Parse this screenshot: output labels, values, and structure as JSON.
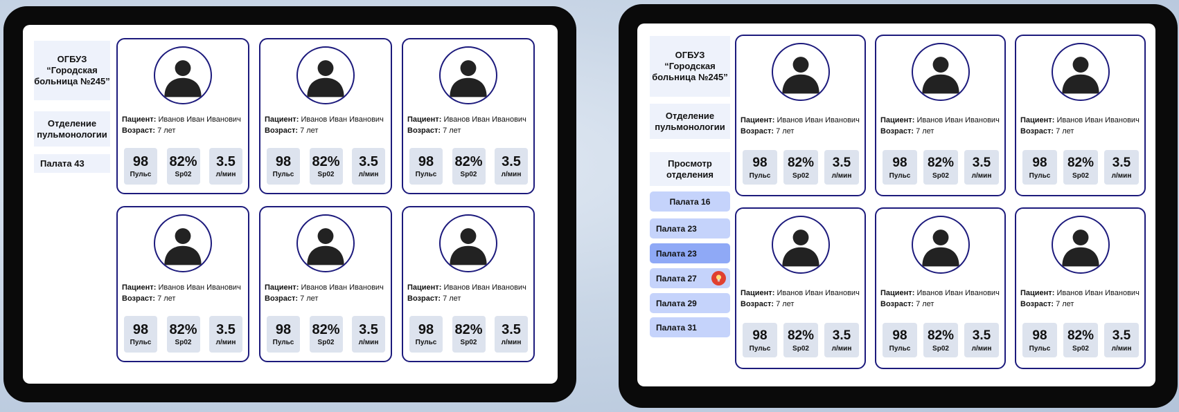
{
  "tablet_a": {
    "hospital": "ОГБУЗ “Городская больница №245”",
    "department": "Отделение пульмонологии",
    "ward": "Палата 43"
  },
  "tablet_b": {
    "hospital": "ОГБУЗ “Городская больница №245”",
    "department": "Отделение пульмонологии",
    "view_department": "Просмотр отделения",
    "wards": [
      {
        "label": "Палата 16"
      },
      {
        "label": "Палата 23"
      },
      {
        "label": "Палата 23"
      },
      {
        "label": "Палата 27",
        "alert_icon": "lightbulb-icon"
      },
      {
        "label": "Палата 29"
      },
      {
        "label": "Палата 31"
      }
    ]
  },
  "patient_card": {
    "patient_label": "Пациент:",
    "patient_name": "Иванов Иван Иванович",
    "age_label": "Возраст:",
    "age_value": "7 лет",
    "pulse_value": "98",
    "pulse_label": "Пульс",
    "spo2_value": "82%",
    "spo2_label": "Sp02",
    "flow_value": "3.5",
    "flow_label": "л/мин"
  },
  "colors": {
    "card_border": "#1c1a7c",
    "ward_button": "#c5d3fb",
    "ward_button_active": "#8fa9f6",
    "alert": "#e04030"
  }
}
